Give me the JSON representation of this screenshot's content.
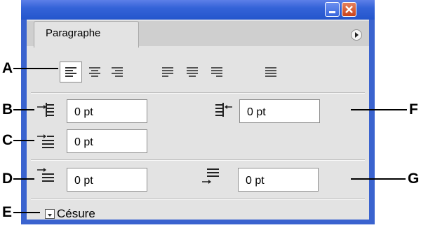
{
  "panel": {
    "tab_label": "Paragraphe",
    "minimize_icon": "minimize-icon",
    "close_icon": "close-icon",
    "menu_icon": "panel-menu-arrow-icon"
  },
  "alignment_buttons": [
    {
      "icon": "align-left-icon",
      "active": true
    },
    {
      "icon": "align-center-icon",
      "active": false
    },
    {
      "icon": "align-right-icon",
      "active": false
    },
    {
      "icon": "justify-last-left-icon",
      "active": false
    },
    {
      "icon": "justify-last-center-icon",
      "active": false
    },
    {
      "icon": "justify-last-right-icon",
      "active": false
    },
    {
      "icon": "justify-all-icon",
      "active": false
    }
  ],
  "fields": {
    "left_indent": "0 pt",
    "right_indent": "0 pt",
    "first_line_indent": "0 pt",
    "space_before": "0 pt",
    "space_after": "0 pt"
  },
  "hyphenation": {
    "label": "Césure",
    "checked": false
  },
  "callouts": {
    "a": "A",
    "b": "B",
    "c": "C",
    "d": "D",
    "e": "E",
    "f": "F",
    "g": "G"
  },
  "colors": {
    "title_bar": "#2a5bd4",
    "close_button": "#d65a30",
    "panel_bg": "#e3e3e3"
  }
}
